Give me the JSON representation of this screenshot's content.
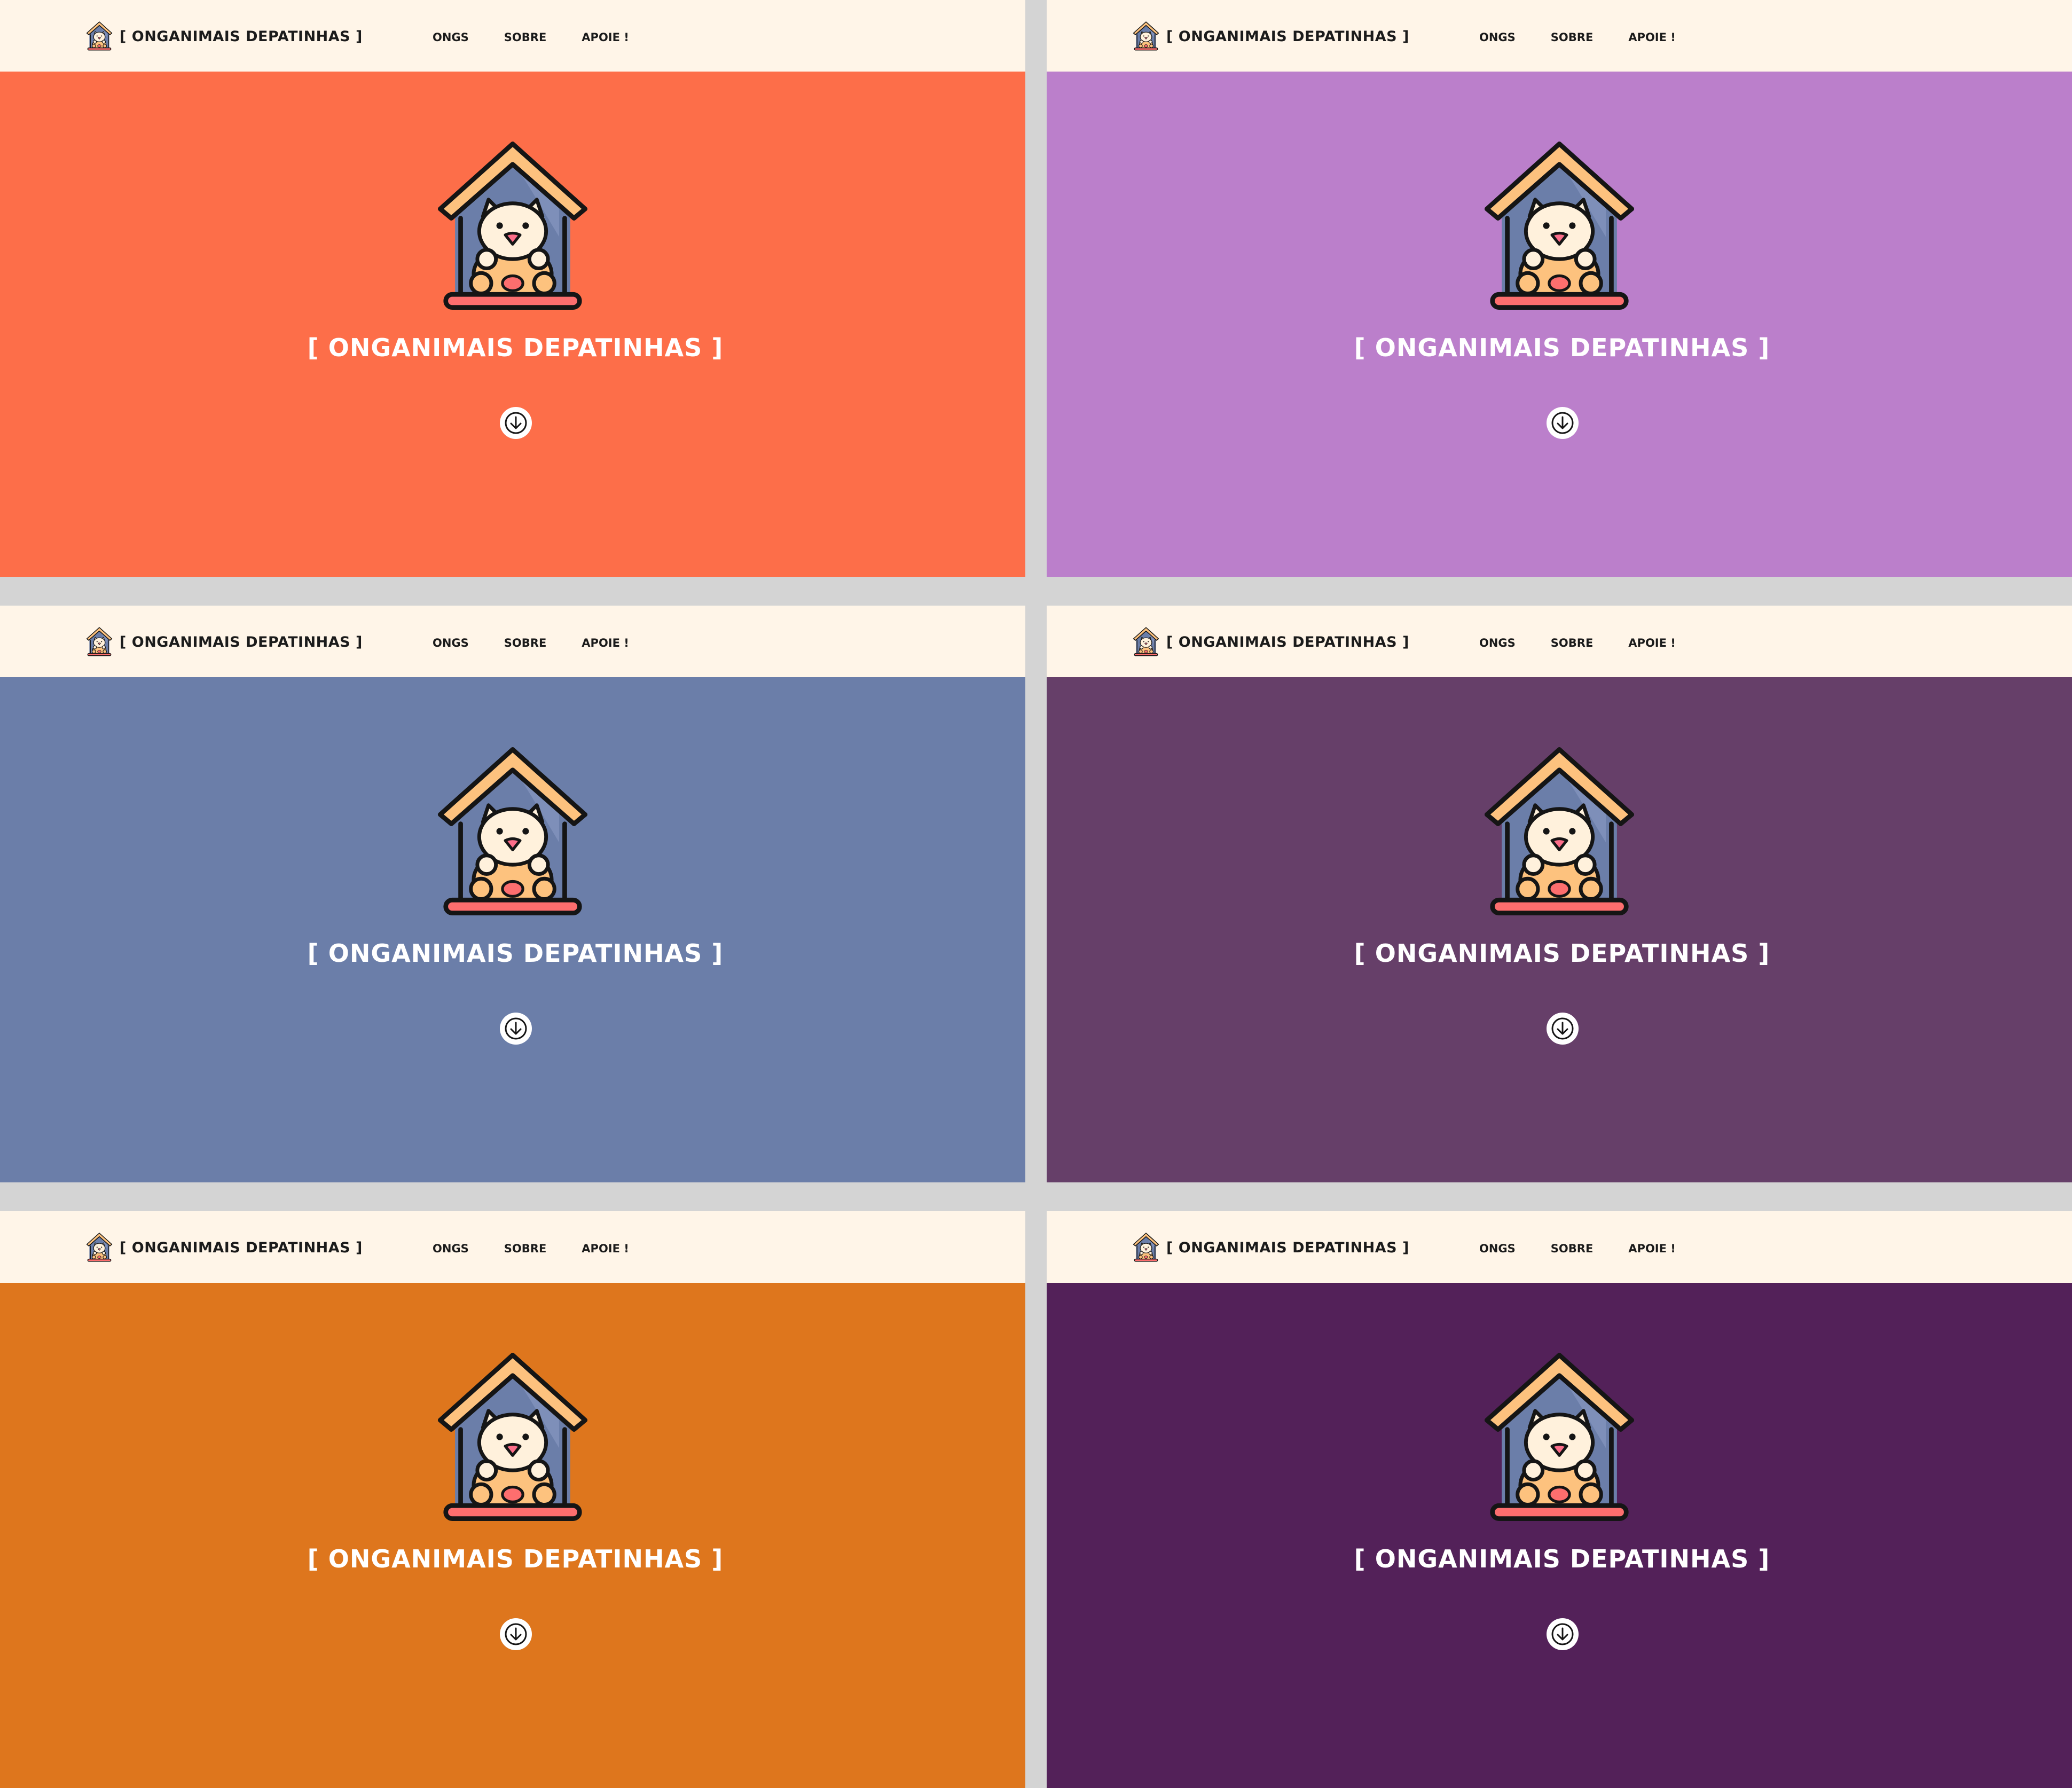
{
  "brand": {
    "name": "[ ONGANIMAIS DEPATINHAS ]",
    "logo_icon": "dog-house-icon"
  },
  "nav": {
    "items": [
      {
        "label": "ONGS"
      },
      {
        "label": "SOBRE"
      },
      {
        "label": "APOIE !"
      }
    ]
  },
  "hero": {
    "title": "[ ONGANIMAIS DEPATINHAS ]",
    "scroll_icon": "arrow-down-icon"
  },
  "colors": {
    "nav_background": "#fff5e8",
    "panel_gap": "#d4d4d4",
    "hero_backgrounds": [
      "#fd6e49",
      "#bb7fcb",
      "#6b7ea9",
      "#663f69",
      "#de761d",
      "#532159"
    ]
  }
}
